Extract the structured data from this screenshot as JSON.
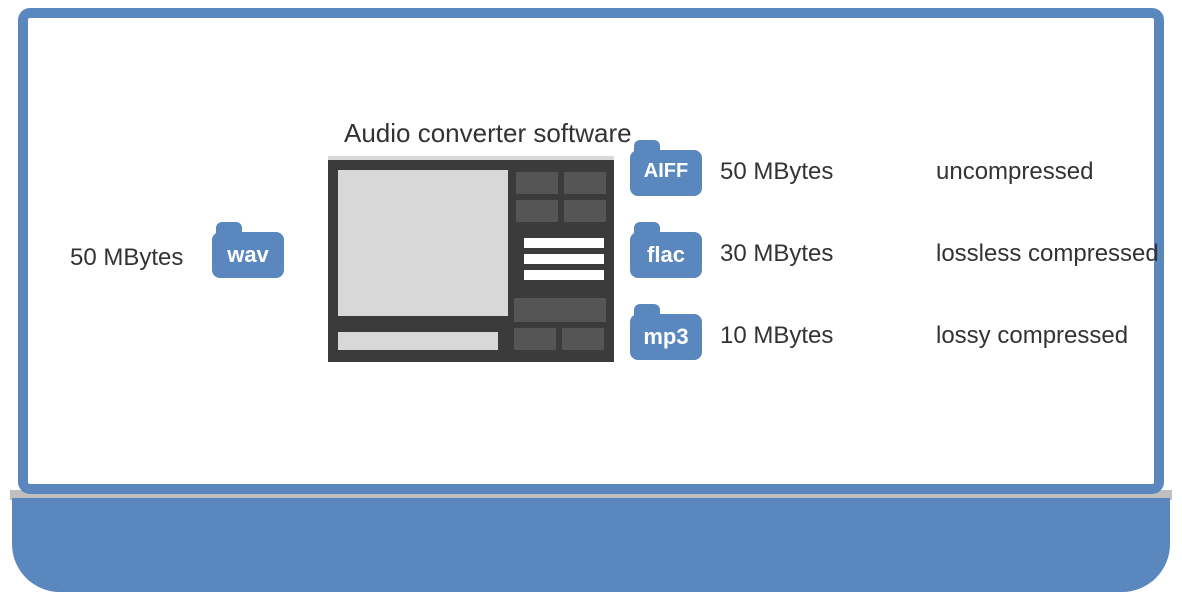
{
  "diagram": {
    "title": "Audio converter software",
    "input": {
      "size": "50 MBytes",
      "format": "wav"
    },
    "outputs": [
      {
        "format": "AIFF",
        "size": "50 MBytes",
        "compression": "uncompressed"
      },
      {
        "format": "flac",
        "size": "30 MBytes",
        "compression": "lossless compressed"
      },
      {
        "format": "mp3",
        "size": "10 MBytes",
        "compression": "lossy compressed"
      }
    ]
  }
}
